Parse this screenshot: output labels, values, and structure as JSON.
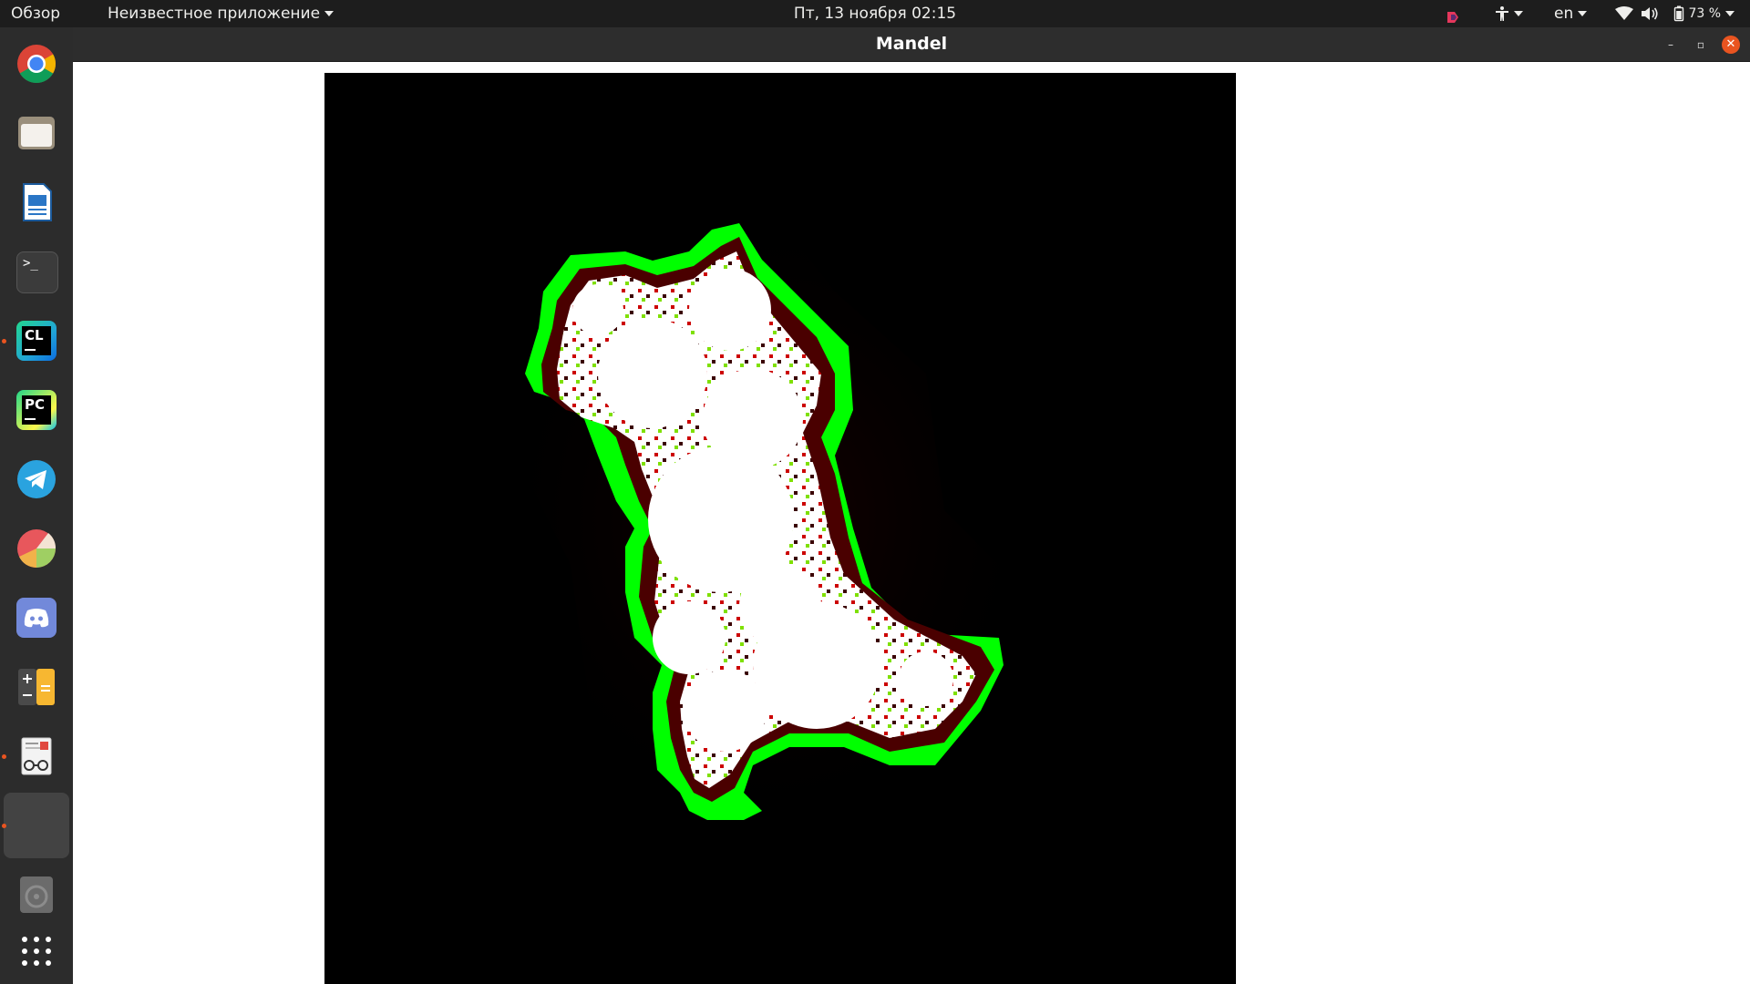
{
  "topbar": {
    "activities": "Обзор",
    "app_menu": "Неизвестное приложение",
    "clock": "Пт, 13 ноября  02:15",
    "language": "en",
    "battery": "73 %"
  },
  "dock": {
    "items": [
      {
        "name": "google-chrome",
        "icon": "chrome-icon",
        "running": false
      },
      {
        "name": "files",
        "icon": "folder-icon",
        "running": false
      },
      {
        "name": "libreoffice-writer",
        "icon": "document-icon",
        "running": false
      },
      {
        "name": "terminal",
        "icon": "terminal-icon",
        "running": false,
        "label": ">_"
      },
      {
        "name": "clion",
        "icon": "clion-icon",
        "running": true,
        "label": "CL"
      },
      {
        "name": "pycharm",
        "icon": "pycharm-icon",
        "running": false,
        "label": "PC"
      },
      {
        "name": "telegram",
        "icon": "telegram-icon",
        "running": false
      },
      {
        "name": "disk-usage",
        "icon": "pie-icon",
        "running": false
      },
      {
        "name": "discord",
        "icon": "discord-icon",
        "running": false
      },
      {
        "name": "calculator",
        "icon": "calculator-icon",
        "running": false
      },
      {
        "name": "document-viewer",
        "icon": "reader-icon",
        "running": true
      },
      {
        "name": "mandel-app",
        "icon": "blank-app-icon",
        "running": true,
        "active": true
      },
      {
        "name": "optical-drive",
        "icon": "disc-icon",
        "running": false
      }
    ],
    "show_apps_icon": "grid-icon"
  },
  "window": {
    "title": "Mandel",
    "minimize": "–",
    "maximize": "▫",
    "close": "✕"
  },
  "render": {
    "type": "fractal-escape-time",
    "colors": {
      "inside": "#ffffff",
      "band_outer": "#00ff00",
      "dark": "#4a0000",
      "red": "#cc0000",
      "background": "#000000"
    }
  },
  "colors": {
    "accent": "#e95420",
    "topbar": "#1d1d1d",
    "dock": "#2c2c2c"
  }
}
